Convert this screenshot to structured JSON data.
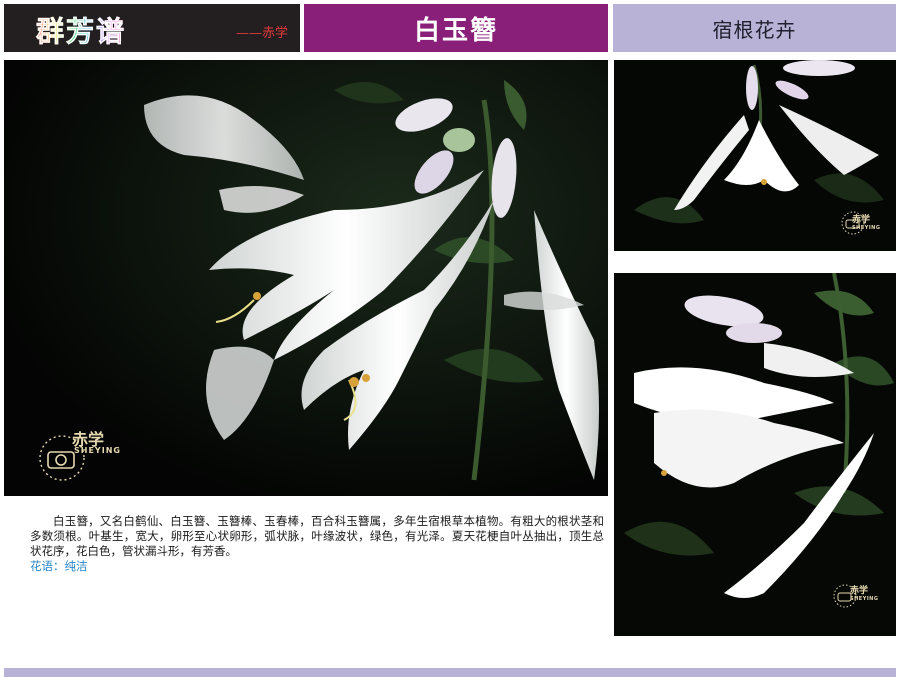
{
  "header": {
    "brand": "群芳谱",
    "author": "——赤学",
    "title": "白玉簪",
    "category": "宿根花卉"
  },
  "colors": {
    "brand_bar": "#231f20",
    "title_bar": "#8a1f7a",
    "category_bar": "#b8b2d6",
    "flower_language": "#2a86c8"
  },
  "photos": {
    "main": {
      "subject": "white hosta flowers on dark background"
    },
    "top_right": {
      "subject": "hanging white hosta flowers"
    },
    "bottom_right": {
      "subject": "white hosta blossoms and buds"
    }
  },
  "watermark": {
    "name": "赤学",
    "sub": "SHEYING",
    "icon": "camera-icon"
  },
  "content": {
    "description": "白玉簪，又名白鹤仙、白玉簪、玉簪棒、玉春棒，百合科玉簪属，多年生宿根草本植物。有粗大的根状茎和多数须根。叶基生，宽大，卵形至心状卵形，弧状脉，叶缘波状，绿色，有光泽。夏天花梗自叶丛抽出，顶生总状花序，花白色，管状漏斗形，有芳香。",
    "flower_language": "花语：纯洁"
  }
}
